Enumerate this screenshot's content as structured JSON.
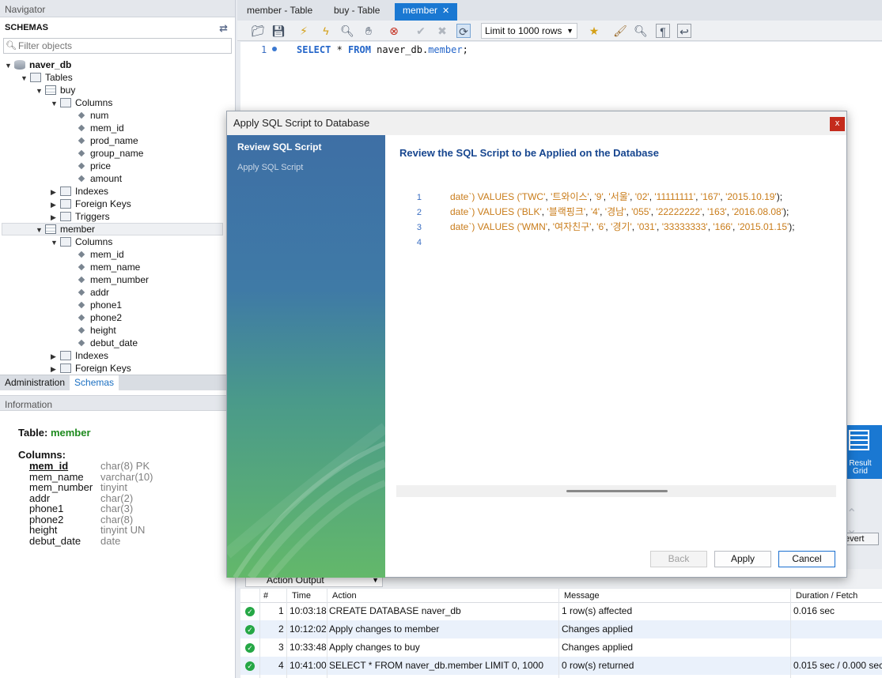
{
  "navigator": {
    "title": "Navigator",
    "schemas_label": "SCHEMAS",
    "filter_placeholder": "Filter objects",
    "tree": [
      {
        "label": "naver_db",
        "bold": true
      },
      {
        "label": "Tables"
      },
      {
        "label": "buy"
      },
      {
        "label": "Columns"
      },
      {
        "label": "num"
      },
      {
        "label": "mem_id"
      },
      {
        "label": "prod_name"
      },
      {
        "label": "group_name"
      },
      {
        "label": "price"
      },
      {
        "label": "amount"
      },
      {
        "label": "Indexes"
      },
      {
        "label": "Foreign Keys"
      },
      {
        "label": "Triggers"
      },
      {
        "label": "member"
      },
      {
        "label": "Columns"
      },
      {
        "label": "mem_id"
      },
      {
        "label": "mem_name"
      },
      {
        "label": "mem_number"
      },
      {
        "label": "addr"
      },
      {
        "label": "phone1"
      },
      {
        "label": "phone2"
      },
      {
        "label": "height"
      },
      {
        "label": "debut_date"
      },
      {
        "label": "Indexes"
      },
      {
        "label": "Foreign Keys"
      }
    ],
    "bottom_tabs": [
      "Administration",
      "Schemas"
    ]
  },
  "information": {
    "title": "Information",
    "table_label": "Table:",
    "table_name": "member",
    "columns_label": "Columns:",
    "columns": [
      {
        "name": "mem_id",
        "type": "char(8) PK"
      },
      {
        "name": "mem_name",
        "type": "varchar(10)"
      },
      {
        "name": "mem_number",
        "type": "tinyint"
      },
      {
        "name": "addr",
        "type": "char(2)"
      },
      {
        "name": "phone1",
        "type": "char(3)"
      },
      {
        "name": "phone2",
        "type": "char(8)"
      },
      {
        "name": "height",
        "type": "tinyint UN"
      },
      {
        "name": "debut_date",
        "type": "date"
      }
    ]
  },
  "doc_tabs": [
    "member - Table",
    "buy - Table",
    "member"
  ],
  "toolbar": {
    "limit_label": "Limit to 1000 rows"
  },
  "editor": {
    "line_no": "1",
    "sql": {
      "k1": "SELECT",
      "star": " * ",
      "k2": "FROM",
      "db": " naver_db.",
      "tbl": "member",
      "end": ";"
    }
  },
  "result_grid": {
    "label_line1": "Result",
    "label_line2": "Grid"
  },
  "revert_label": "evert",
  "output": {
    "selector_label": "Action Output",
    "headers": [
      "#",
      "Time",
      "Action",
      "Message",
      "Duration / Fetch"
    ],
    "rows": [
      {
        "n": "1",
        "time": "10:03:18",
        "action": "CREATE DATABASE naver_db",
        "message": "1 row(s) affected",
        "duration": "0.016 sec"
      },
      {
        "n": "2",
        "time": "10:12:02",
        "action": "Apply changes to member",
        "message": "Changes applied",
        "duration": ""
      },
      {
        "n": "3",
        "time": "10:33:48",
        "action": "Apply changes to buy",
        "message": "Changes applied",
        "duration": ""
      },
      {
        "n": "4",
        "time": "10:41:00",
        "action": "SELECT * FROM naver_db.member LIMIT 0, 1000",
        "message": "0 row(s) returned",
        "duration": "0.015 sec / 0.000 sec"
      }
    ]
  },
  "dialog": {
    "title": "Apply SQL Script to Database",
    "close_label": "x",
    "steps": [
      "Review SQL Script",
      "Apply SQL Script"
    ],
    "heading": "Review the SQL Script to be Applied on the Database",
    "script_lines": [
      {
        "no": "1",
        "pre": "date`) VALUES (",
        "vals": [
          "'TWC'",
          "'트와이스'",
          "'9'",
          "'서울'",
          "'02'",
          "'11111111'",
          "'167'",
          "'2015.10.19'"
        ],
        "post": ");"
      },
      {
        "no": "2",
        "pre": "date`) VALUES (",
        "vals": [
          "'BLK'",
          "'블랙핑크'",
          "'4'",
          "'경남'",
          "'055'",
          "'22222222'",
          "'163'",
          "'2016.08.08'"
        ],
        "post": ");"
      },
      {
        "no": "3",
        "pre": "date`) VALUES (",
        "vals": [
          "'WMN'",
          "'여자친구'",
          "'6'",
          "'경기'",
          "'031'",
          "'33333333'",
          "'166'",
          "'2015.01.15'"
        ],
        "post": ");"
      },
      {
        "no": "4",
        "pre": "",
        "vals": [],
        "post": ""
      }
    ],
    "buttons": {
      "back": "Back",
      "apply": "Apply",
      "cancel": "Cancel"
    }
  }
}
